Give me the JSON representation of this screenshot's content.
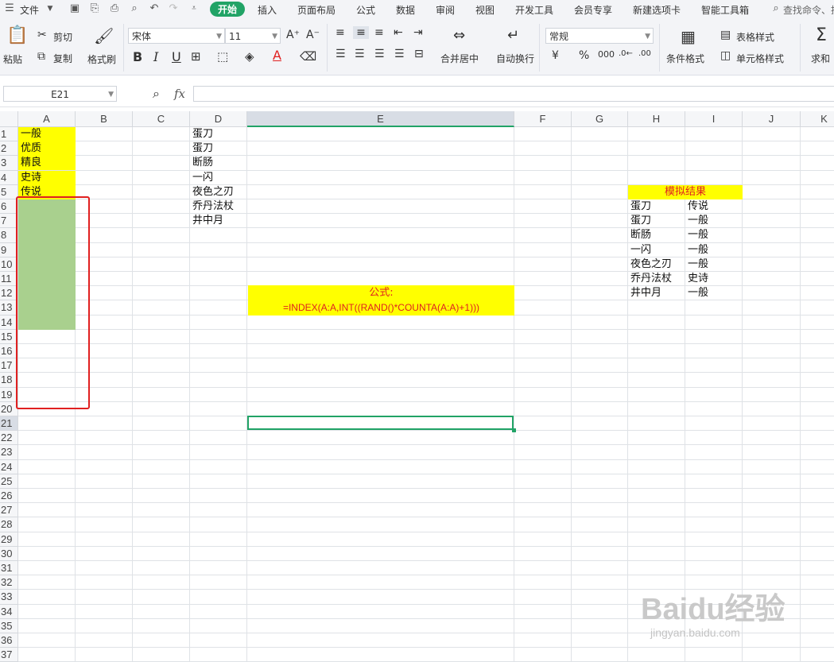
{
  "menu": {
    "file": "文件",
    "tabs": [
      "开始",
      "插入",
      "页面布局",
      "公式",
      "数据",
      "审阅",
      "视图",
      "开发工具",
      "会员专享",
      "新建选项卡",
      "智能工具箱"
    ],
    "search": "查找命令、搜"
  },
  "ribbon": {
    "paste": "粘贴",
    "cut": "剪切",
    "copy": "复制",
    "format_painter": "格式刷",
    "font_name": "宋体",
    "font_size": "11",
    "merge_center": "合并居中",
    "auto_wrap": "自动换行",
    "number_format": "常规",
    "conditional_format": "条件格式",
    "table_style": "表格样式",
    "cell_style": "单元格样式",
    "sum": "求和"
  },
  "formula_bar": {
    "name_box": "E21",
    "fx": "fx",
    "value": ""
  },
  "columns": [
    "A",
    "B",
    "C",
    "D",
    "E",
    "F",
    "G",
    "H",
    "I",
    "J",
    "K"
  ],
  "rows": [
    "1",
    "2",
    "3",
    "4",
    "5",
    "6",
    "7",
    "8",
    "9",
    "10",
    "11",
    "12",
    "13",
    "14",
    "15",
    "16",
    "17",
    "18",
    "19",
    "20",
    "21",
    "22",
    "23",
    "24",
    "25",
    "26",
    "27",
    "28",
    "29",
    "30",
    "31",
    "32",
    "33",
    "34",
    "35",
    "36",
    "37"
  ],
  "selected_cell": "E21",
  "col_a": [
    "一般",
    "优质",
    "精良",
    "史诗",
    "传说"
  ],
  "col_d": [
    "蛋刀",
    "蛋刀",
    "断肠",
    "一闪",
    "夜色之刃",
    "乔丹法杖",
    "井中月"
  ],
  "formula_note": {
    "label": "公式:",
    "formula": "=INDEX(A:A,INT((RAND()*COUNTA(A:A)+1)))"
  },
  "sim": {
    "title": "模拟结果",
    "rows": [
      [
        "蛋刀",
        "传说"
      ],
      [
        "蛋刀",
        "一般"
      ],
      [
        "断肠",
        "一般"
      ],
      [
        "一闪",
        "一般"
      ],
      [
        "夜色之刃",
        "一般"
      ],
      [
        "乔丹法杖",
        "史诗"
      ],
      [
        "井中月",
        "一般"
      ]
    ]
  },
  "watermark": {
    "brand": "Baidu经验",
    "url": "jingyan.baidu.com"
  },
  "colors": {
    "accent": "#21a366",
    "highlight": "#ffff00",
    "fill_green": "#a9d08e",
    "annotation_red": "#e02020"
  }
}
